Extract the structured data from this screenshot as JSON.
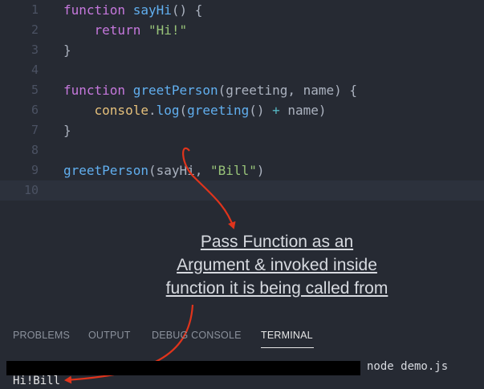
{
  "editor": {
    "lines": [
      {
        "n": "1",
        "t": [
          [
            "kw",
            "function "
          ],
          [
            "fn",
            "sayHi"
          ],
          [
            "pl",
            "() {"
          ]
        ]
      },
      {
        "n": "2",
        "t": [
          [
            "pl",
            "    "
          ],
          [
            "kw",
            "return "
          ],
          [
            "str",
            "\"Hi!\""
          ]
        ]
      },
      {
        "n": "3",
        "t": [
          [
            "pl",
            "}"
          ]
        ]
      },
      {
        "n": "4",
        "t": []
      },
      {
        "n": "5",
        "t": [
          [
            "kw",
            "function "
          ],
          [
            "fn",
            "greetPerson"
          ],
          [
            "pl",
            "(greeting, name) {"
          ]
        ]
      },
      {
        "n": "6",
        "t": [
          [
            "pl",
            "    "
          ],
          [
            "obj",
            "console"
          ],
          [
            "pl",
            "."
          ],
          [
            "fn",
            "log"
          ],
          [
            "pl",
            "("
          ],
          [
            "fn",
            "greeting"
          ],
          [
            "pl",
            "() "
          ],
          [
            "op",
            "+"
          ],
          [
            "pl",
            " name)"
          ]
        ]
      },
      {
        "n": "7",
        "t": [
          [
            "pl",
            "}"
          ]
        ]
      },
      {
        "n": "8",
        "t": []
      },
      {
        "n": "9",
        "t": [
          [
            "fn",
            "greetPerson"
          ],
          [
            "pl",
            "(sayHi, "
          ],
          [
            "str",
            "\"Bill\""
          ],
          [
            "pl",
            ")"
          ]
        ]
      },
      {
        "n": "10",
        "t": []
      }
    ]
  },
  "annotation": {
    "line1": "Pass Function as an",
    "line2": "Argument & invoked inside",
    "line3": "function it is being called from"
  },
  "panel": {
    "tabs": [
      "PROBLEMS",
      "OUTPUT",
      "DEBUG CONSOLE",
      "TERMINAL"
    ],
    "active_tab": "TERMINAL"
  },
  "terminal": {
    "command": "node demo.js",
    "output": "Hi!Bill"
  },
  "colors": {
    "arrow": "#e0341c",
    "background": "#262a33"
  }
}
